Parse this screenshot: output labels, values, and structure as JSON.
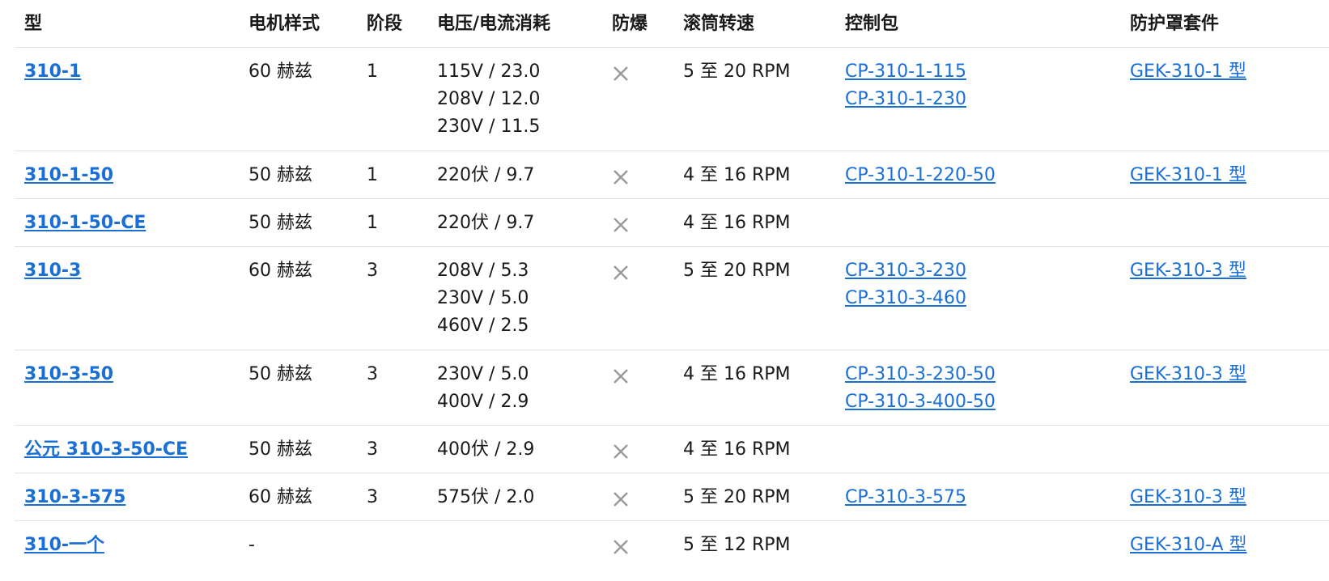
{
  "headers": {
    "model": "型",
    "motor": "电机样式",
    "phase": "阶段",
    "voltage": "电压/电流消耗",
    "explosion_proof": "防爆",
    "drum_speed": "滚筒转速",
    "control_package": "控制包",
    "guard_kit": "防护罩套件"
  },
  "rows": [
    {
      "model": "310-1",
      "motor": "60 赫兹",
      "phase": "1",
      "voltages": [
        "115V / 23.0",
        "208V / 12.0",
        "230V / 11.5"
      ],
      "explosion_proof_icon": "x-icon",
      "rpm": "5 至 20 RPM",
      "control_packages": [
        "CP-310-1-115",
        "CP-310-1-230"
      ],
      "guard_kit": "GEK-310-1 型"
    },
    {
      "model": "310-1-50",
      "motor": "50 赫兹",
      "phase": "1",
      "voltages": [
        "220伏 / 9.7"
      ],
      "explosion_proof_icon": "x-icon",
      "rpm": "4 至 16 RPM",
      "control_packages": [
        "CP-310-1-220-50"
      ],
      "guard_kit": "GEK-310-1 型"
    },
    {
      "model": "310-1-50-CE",
      "motor": "50 赫兹",
      "phase": "1",
      "voltages": [
        "220伏 / 9.7"
      ],
      "explosion_proof_icon": "x-icon",
      "rpm": "4 至 16 RPM",
      "control_packages": [],
      "guard_kit": ""
    },
    {
      "model": "310-3",
      "motor": "60 赫兹",
      "phase": "3",
      "voltages": [
        "208V / 5.3",
        "230V / 5.0",
        "460V / 2.5"
      ],
      "explosion_proof_icon": "x-icon",
      "rpm": "5 至 20 RPM",
      "control_packages": [
        "CP-310-3-230",
        "CP-310-3-460"
      ],
      "guard_kit": "GEK-310-3 型"
    },
    {
      "model": "310-3-50",
      "motor": "50 赫兹",
      "phase": "3",
      "voltages": [
        "230V / 5.0",
        "400V / 2.9"
      ],
      "explosion_proof_icon": "x-icon",
      "rpm": "4 至 16 RPM",
      "control_packages": [
        "CP-310-3-230-50",
        "CP-310-3-400-50"
      ],
      "guard_kit": "GEK-310-3 型"
    },
    {
      "model": "公元 310-3-50-CE",
      "motor": "50 赫兹",
      "phase": "3",
      "voltages": [
        "400伏 / 2.9"
      ],
      "explosion_proof_icon": "x-icon",
      "rpm": "4 至 16 RPM",
      "control_packages": [],
      "guard_kit": ""
    },
    {
      "model": "310-3-575",
      "motor": "60 赫兹",
      "phase": "3",
      "voltages": [
        "575伏 / 2.0"
      ],
      "explosion_proof_icon": "x-icon",
      "rpm": "5 至 20 RPM",
      "control_packages": [
        "CP-310-3-575"
      ],
      "guard_kit": "GEK-310-3 型"
    },
    {
      "model": "310-一个",
      "motor": "-",
      "phase": "",
      "voltages": [],
      "explosion_proof_icon": "x-icon",
      "rpm": "5 至 12 RPM",
      "control_packages": [],
      "guard_kit": "GEK-310-A 型"
    }
  ],
  "colors": {
    "link": "#1a6fd6",
    "divider": "#e3e3e3",
    "icon": "#9a9a9a"
  }
}
